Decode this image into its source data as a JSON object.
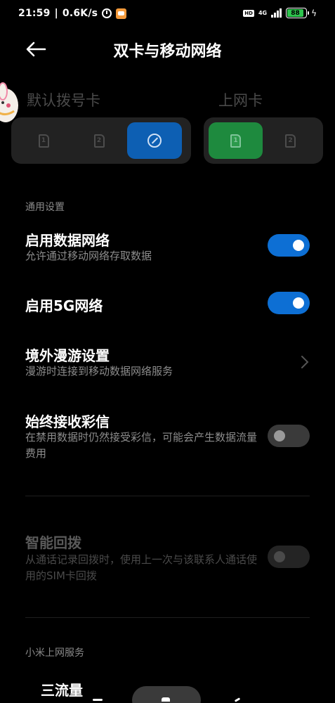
{
  "status_bar": {
    "time": "21:59",
    "speed": "0.6K/s",
    "hd": "HD",
    "network_type": "4G",
    "battery": "88"
  },
  "header": {
    "title": "双卡与移动网络"
  },
  "sim_selection": {
    "dial_label": "默认拨号卡",
    "data_label": "上网卡",
    "dial_options": [
      "1",
      "2"
    ],
    "data_options": [
      "1",
      "2"
    ]
  },
  "section_general": "通用设置",
  "settings": {
    "enable_data": {
      "title": "启用数据网络",
      "subtitle": "允许通过移动网络存取数据",
      "enabled": true
    },
    "enable_5g": {
      "title": "启用5G网络",
      "enabled": true
    },
    "roaming": {
      "title": "境外漫游设置",
      "subtitle": "漫游时连接到移动数据网络服务"
    },
    "mms": {
      "title": "始终接收彩信",
      "subtitle": "在禁用数据时仍然接受彩信，可能会产生数据流量费用",
      "enabled": false
    },
    "smart_redial": {
      "title": "智能回拨",
      "subtitle": "从通话记录回拨时，使用上一次与该联系人通话使用的SIM卡回拨",
      "enabled": false
    }
  },
  "section_xiaomi": "小米上网服务",
  "partial_item": "三流量",
  "colors": {
    "accent": "#0d6fd4",
    "data_sim": "#1e8a3e",
    "background": "#000000"
  },
  "icons": {
    "back": "back-arrow-icon",
    "chevron": "chevron-right-icon",
    "edit": "pencil-circle-icon"
  }
}
